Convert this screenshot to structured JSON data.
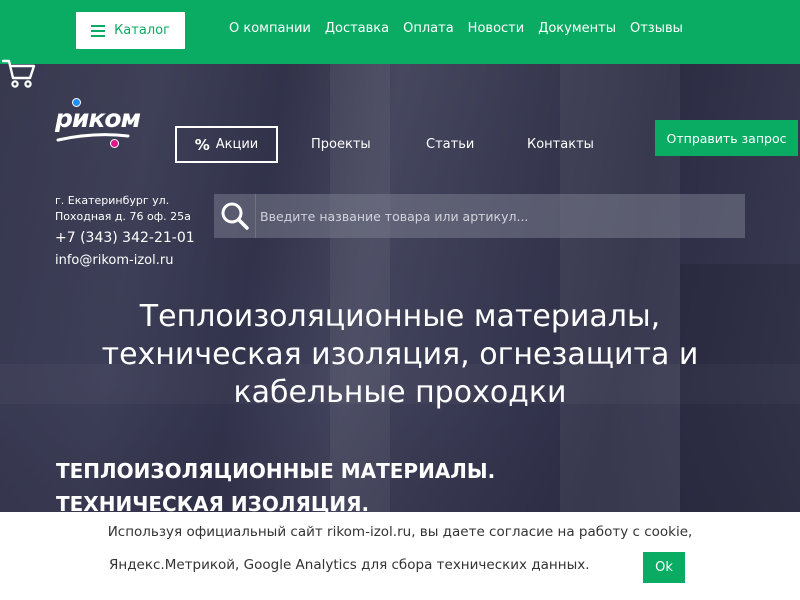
{
  "colors": {
    "brand_green": "#0aab63",
    "hero_overlay": "#2e2f45",
    "white": "#ffffff"
  },
  "topbar": {
    "catalog_label": "Каталог",
    "nav": [
      "О компании",
      "Доставка",
      "Оплата",
      "Новости",
      "Документы",
      "Отзывы"
    ]
  },
  "logo": {
    "text": "рик",
    "text_tail": "ом"
  },
  "subnav": {
    "sale_label": "Акции",
    "sale_icon": "%",
    "projects": "Проекты",
    "articles": "Статьи",
    "contacts": "Контакты"
  },
  "request_button": "Отправить запрос",
  "contacts_block": {
    "address_line1": "г. Екатеринбург ул.",
    "address_line2": "Походная д. 76 оф. 25а",
    "phone": "+7 (343) 342-21-01",
    "email": "info@rikom-izol.ru"
  },
  "search": {
    "placeholder": "Введите название товара или артикул..."
  },
  "hero": {
    "headline_line1": "Теплоизоляционные материалы,",
    "headline_line2": "техническая изоляция, огнезащита и",
    "headline_line3": "кабельные проходки",
    "subheadline_line1": "ТЕПЛОИЗОЛЯЦИОННЫЕ МАТЕРИАЛЫ.",
    "subheadline_line2": "ТЕХНИЧЕСКАЯ ИЗОЛЯЦИЯ."
  },
  "cookie": {
    "line1": "Используя официальный сайт rikom-izol.ru, вы даете согласие на работу с cookie,",
    "line2": "Яндекс.Метрикой, Google Analytics для сбора технических данных.",
    "ok_label": "Ok"
  }
}
